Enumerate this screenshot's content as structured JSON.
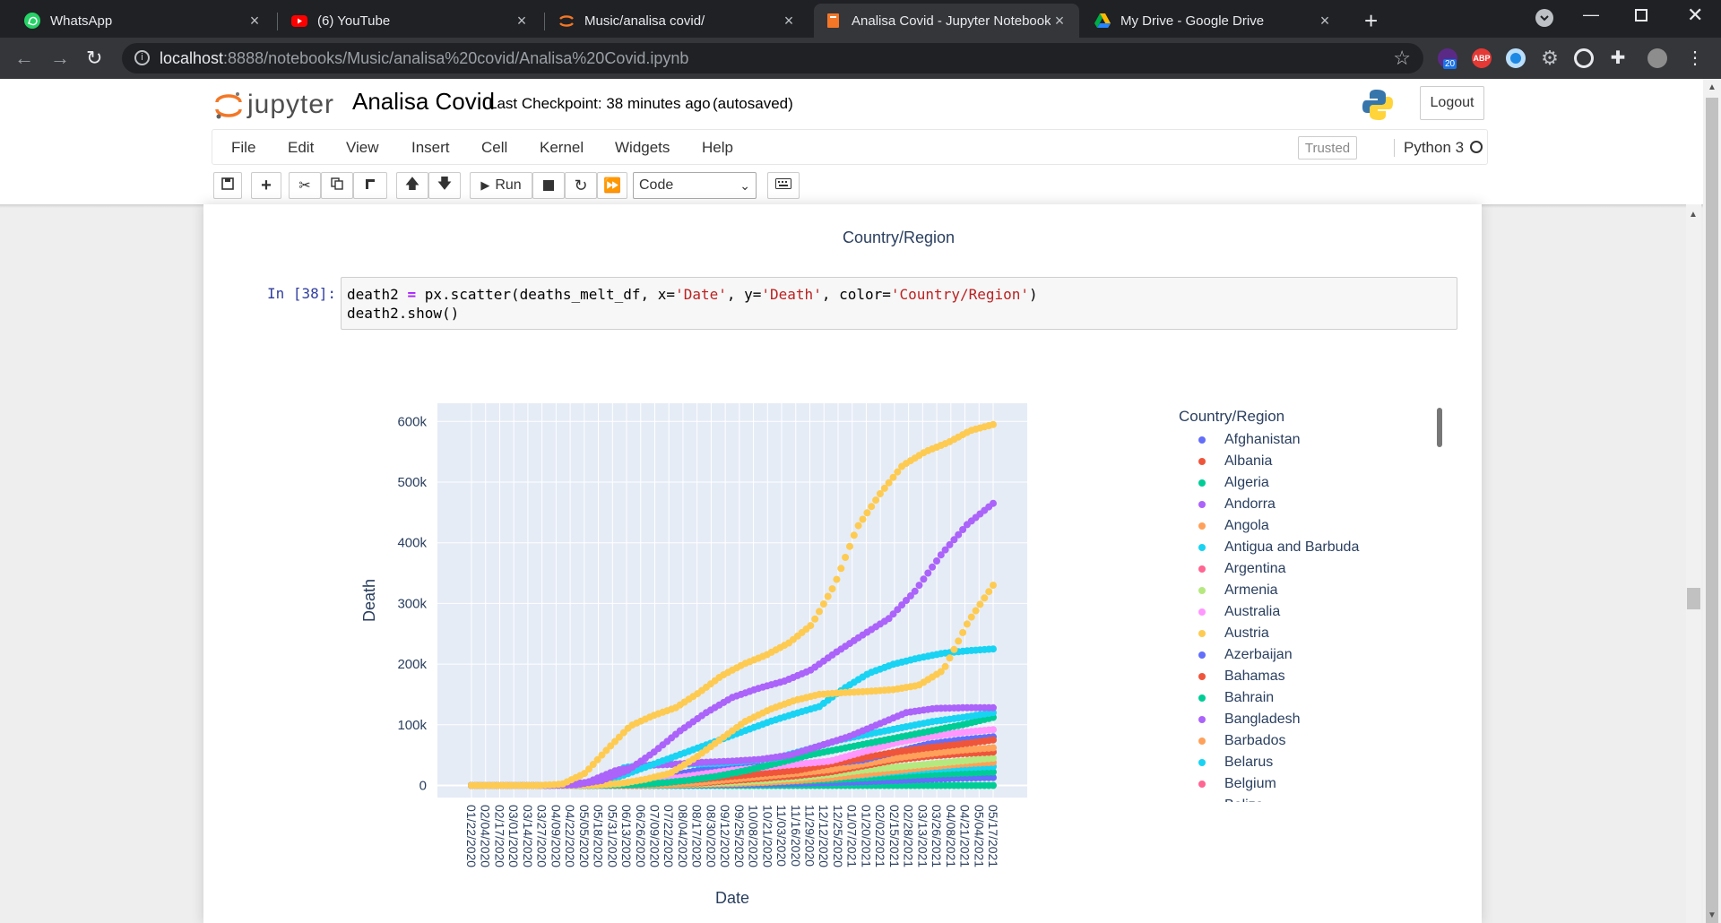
{
  "tabs": [
    {
      "title": "WhatsApp",
      "icon": "whatsapp-icon",
      "active": false
    },
    {
      "title": "(6) YouTube",
      "icon": "youtube-icon",
      "active": false
    },
    {
      "title": "Music/analisa covid/",
      "icon": "jupyter-icon",
      "active": false
    },
    {
      "title": "Analisa Covid - Jupyter Notebook",
      "icon": "jupyter-notebook-icon",
      "active": true
    },
    {
      "title": "My Drive - Google Drive",
      "icon": "google-drive-icon",
      "active": false
    }
  ],
  "address": {
    "host": "localhost",
    "path": ":8888/notebooks/Music/analisa%20covid/Analisa%20Covid.ipynb"
  },
  "extensions": {
    "badge_count": "20",
    "adblock": "ABP"
  },
  "jupyter": {
    "logo_text": "jupyter",
    "notebook_name": "Analisa Covid",
    "checkpoint": "Last Checkpoint: 38 minutes ago",
    "autosave": "(autosaved)",
    "logout": "Logout",
    "trusted": "Trusted",
    "kernel": "Python 3"
  },
  "menu": [
    "File",
    "Edit",
    "View",
    "Insert",
    "Cell",
    "Kernel",
    "Widgets",
    "Help"
  ],
  "toolbar": {
    "run_label": "Run",
    "cell_type": "Code"
  },
  "notebook": {
    "prev_output_label": "Country/Region",
    "prompt": "In [38]:",
    "code_parts": {
      "l1a": "death2 ",
      "l1b": "=",
      "l1c": " px.scatter(deaths_melt_df, x=",
      "l1d": "'Date'",
      "l1e": ", y=",
      "l1f": "'Death'",
      "l1g": ", color=",
      "l1h": "'Country/Region'",
      "l1i": ")",
      "l2": "death2.show()"
    }
  },
  "chart_data": {
    "type": "scatter",
    "xlabel": "Date",
    "ylabel": "Death",
    "legend_title": "Country/Region",
    "legend_position": "right",
    "ylim": [
      -20000,
      630000
    ],
    "y_ticks": [
      0,
      100000,
      200000,
      300000,
      400000,
      500000,
      600000
    ],
    "y_tick_labels": [
      "0",
      "100k",
      "200k",
      "300k",
      "400k",
      "500k",
      "600k"
    ],
    "x_tick_labels": [
      "01/22/2020",
      "02/04/2020",
      "02/17/2020",
      "03/01/2020",
      "03/14/2020",
      "03/27/2020",
      "04/09/2020",
      "04/22/2020",
      "05/05/2020",
      "05/18/2020",
      "05/31/2020",
      "06/13/2020",
      "06/26/2020",
      "07/09/2020",
      "07/22/2020",
      "08/04/2020",
      "08/17/2020",
      "08/30/2020",
      "09/12/2020",
      "09/25/2020",
      "10/08/2020",
      "10/21/2020",
      "11/03/2020",
      "11/16/2020",
      "11/29/2020",
      "12/12/2020",
      "12/25/2020",
      "01/07/2021",
      "01/20/2021",
      "02/02/2021",
      "02/15/2021",
      "02/28/2021",
      "03/13/2021",
      "03/26/2021",
      "04/08/2021",
      "04/21/2021",
      "05/04/2021",
      "05/17/2021"
    ],
    "series": [
      {
        "color": "#FECB52",
        "values": [
          0,
          0,
          0,
          0,
          2000,
          20000,
          60000,
          98000,
          115000,
          128000,
          152000,
          180000,
          200000,
          215000,
          235000,
          265000,
          330000,
          425000,
          480000,
          527000,
          550000,
          565000,
          585000,
          595000
        ]
      },
      {
        "color": "#AB63FA",
        "values": [
          0,
          0,
          0,
          0,
          1000,
          8000,
          25000,
          55000,
          90000,
          120000,
          145000,
          160000,
          172000,
          190000,
          220000,
          248000,
          275000,
          320000,
          380000,
          430000,
          465000
        ]
      },
      {
        "color": "#FECB52",
        "values": [
          0,
          0,
          0,
          0,
          0,
          500,
          3000,
          10000,
          20000,
          45000,
          75000,
          105000,
          125000,
          140000,
          150000,
          153000,
          155000,
          158000,
          165000,
          190000,
          270000,
          330000
        ]
      },
      {
        "color": "#19D3F3",
        "values": [
          0,
          0,
          0,
          0,
          0,
          5000,
          15000,
          30000,
          45000,
          60000,
          75000,
          90000,
          105000,
          118000,
          130000,
          160000,
          185000,
          200000,
          210000,
          218000,
          222000,
          225000
        ]
      },
      {
        "color": "#AB63FA",
        "values": [
          0,
          0,
          0,
          0,
          5000,
          25000,
          33000,
          35000,
          38000,
          40000,
          43000,
          50000,
          65000,
          80000,
          100000,
          120000,
          127000,
          128000,
          128000
        ]
      },
      {
        "color": "#19D3F3",
        "values": [
          0,
          0,
          0,
          0,
          3000,
          30000,
          34000,
          35000,
          36000,
          40000,
          46000,
          60000,
          75000,
          85000,
          95000,
          105000,
          112000,
          120000
        ]
      },
      {
        "color": "#00CC96",
        "values": [
          0,
          0,
          0,
          0,
          0,
          1000,
          3000,
          8000,
          15000,
          25000,
          37000,
          50000,
          60000,
          70000,
          80000,
          90000,
          100000,
          112000
        ]
      },
      {
        "color": "#FF97FF",
        "values": [
          0,
          0,
          0,
          0,
          0,
          2000,
          10000,
          18000,
          25000,
          30000,
          35000,
          40000,
          55000,
          70000,
          80000,
          87000,
          92000
        ]
      },
      {
        "color": "#EF553B",
        "values": [
          0,
          0,
          0,
          0,
          0,
          1000,
          5000,
          10000,
          15000,
          20000,
          25000,
          35000,
          45000,
          55000,
          62000,
          68000,
          75000
        ]
      },
      {
        "color": "#636EFA",
        "values": [
          0,
          0,
          0,
          0,
          0,
          3000,
          15000,
          25000,
          30000,
          32000,
          34000,
          36000,
          42000,
          55000,
          68000,
          75000,
          80000
        ]
      },
      {
        "color": "#FFA15A",
        "values": [
          0,
          0,
          0,
          0,
          0,
          500,
          2000,
          5000,
          10000,
          15000,
          20000,
          26000,
          35000,
          45000,
          52000,
          58000,
          62000
        ]
      },
      {
        "color": "#EF553B",
        "values": [
          0,
          0,
          0,
          0,
          0,
          500,
          2000,
          4000,
          8000,
          12000,
          16000,
          22000,
          32000,
          42000,
          48000,
          52000,
          55000
        ]
      },
      {
        "color": "#B6E880",
        "values": [
          0,
          0,
          0,
          0,
          0,
          500,
          1500,
          3000,
          5000,
          8000,
          12000,
          18000,
          25000,
          30000,
          35000,
          40000,
          45000
        ]
      },
      {
        "color": "#FFA15A",
        "values": [
          0,
          0,
          0,
          0,
          0,
          200,
          1000,
          2000,
          3000,
          5000,
          8000,
          12000,
          18000,
          24000,
          30000,
          35000,
          38000
        ]
      },
      {
        "color": "#19D3F3",
        "values": [
          0,
          0,
          0,
          0,
          0,
          300,
          2000,
          4000,
          6000,
          8000,
          10000,
          13000,
          17000,
          22000,
          26000,
          29000,
          31000
        ]
      },
      {
        "color": "#00CC96",
        "values": [
          0,
          0,
          0,
          0,
          0,
          100,
          500,
          1500,
          3000,
          5000,
          7000,
          9000,
          12000,
          15000,
          18000,
          20000,
          22000
        ]
      },
      {
        "color": "#636EFA",
        "values": [
          0,
          0,
          0,
          0,
          0,
          100,
          300,
          800,
          1500,
          2500,
          3500,
          4500,
          6000,
          8000,
          10000,
          12000,
          13000
        ]
      },
      {
        "color": "#00CC96",
        "values": [
          0,
          0,
          0,
          0,
          0,
          0,
          0,
          0,
          0,
          0,
          0,
          0,
          0,
          0,
          0,
          0,
          0,
          0,
          0,
          0,
          0,
          0,
          0,
          0
        ]
      }
    ],
    "legend_entries": [
      {
        "name": "Afghanistan",
        "color": "#636EFA"
      },
      {
        "name": "Albania",
        "color": "#EF553B"
      },
      {
        "name": "Algeria",
        "color": "#00CC96"
      },
      {
        "name": "Andorra",
        "color": "#AB63FA"
      },
      {
        "name": "Angola",
        "color": "#FFA15A"
      },
      {
        "name": "Antigua and Barbuda",
        "color": "#19D3F3"
      },
      {
        "name": "Argentina",
        "color": "#FF6692"
      },
      {
        "name": "Armenia",
        "color": "#B6E880"
      },
      {
        "name": "Australia",
        "color": "#FF97FF"
      },
      {
        "name": "Austria",
        "color": "#FECB52"
      },
      {
        "name": "Azerbaijan",
        "color": "#636EFA"
      },
      {
        "name": "Bahamas",
        "color": "#EF553B"
      },
      {
        "name": "Bahrain",
        "color": "#00CC96"
      },
      {
        "name": "Bangladesh",
        "color": "#AB63FA"
      },
      {
        "name": "Barbados",
        "color": "#FFA15A"
      },
      {
        "name": "Belarus",
        "color": "#19D3F3"
      },
      {
        "name": "Belgium",
        "color": "#FF6692"
      },
      {
        "name": "Belize",
        "color": "#B6E880"
      }
    ]
  }
}
